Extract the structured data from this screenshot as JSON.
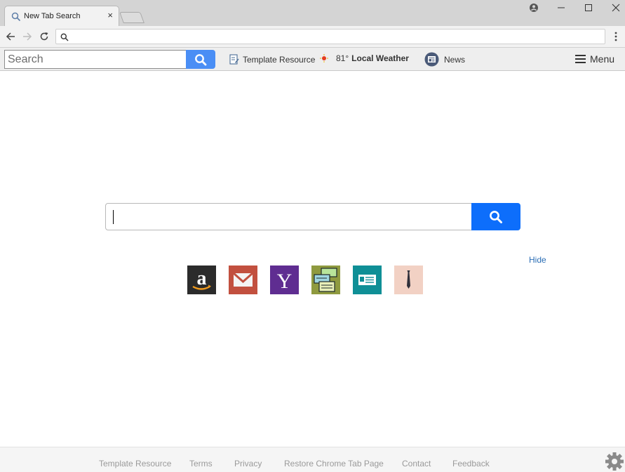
{
  "browser": {
    "tab_title": "New Tab Search",
    "tab_close": "×",
    "omnibox_value": ""
  },
  "extension_bar": {
    "search_placeholder": "Search",
    "template_label": "Template Resource",
    "weather_temp": "81°",
    "weather_label": "Local Weather",
    "news_label": "News",
    "menu_label": "Menu"
  },
  "main": {
    "search_value": "",
    "hide_label": "Hide",
    "tiles": [
      {
        "name": "amazon",
        "icon": "amazon-icon",
        "color": "#232f3e"
      },
      {
        "name": "gmail",
        "icon": "gmail-icon",
        "color": "#c2503f"
      },
      {
        "name": "yahoo",
        "icon": "yahoo-icon",
        "color": "#5f2d91"
      },
      {
        "name": "template",
        "icon": "document-stack-icon",
        "color": "#9aa04a"
      },
      {
        "name": "contact-card",
        "icon": "id-card-icon",
        "color": "#0f8f96"
      },
      {
        "name": "job",
        "icon": "tie-icon",
        "color": "#f2d1c4"
      }
    ]
  },
  "footer": {
    "links": [
      "Template Resource",
      "Terms",
      "Privacy",
      "Restore Chrome Tab Page",
      "Contact",
      "Feedback"
    ]
  },
  "colors": {
    "accent_blue": "#0d6efb",
    "toolbar_search_blue": "#4a8ef5"
  }
}
